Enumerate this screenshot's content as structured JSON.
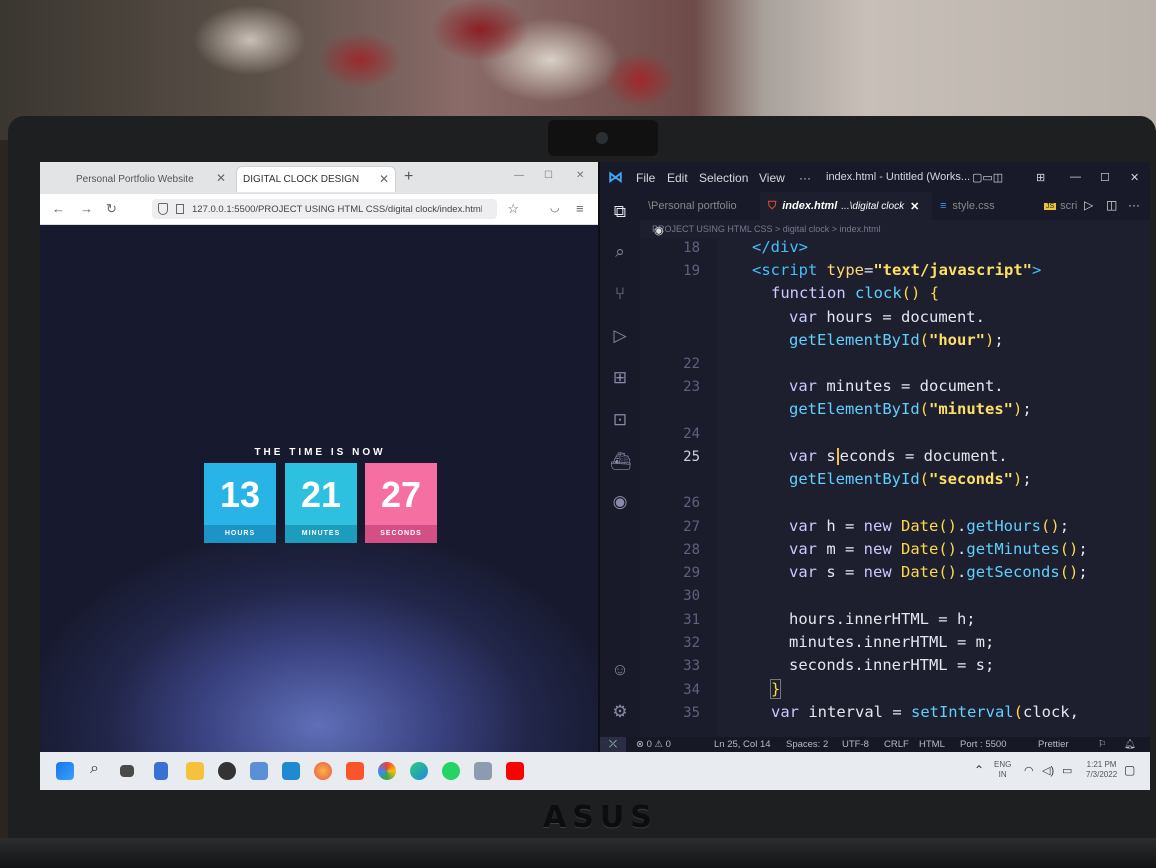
{
  "browser": {
    "tabs": [
      {
        "label": "Personal Portfolio Website"
      },
      {
        "label": "DIGITAL CLOCK DESIGN"
      }
    ],
    "new_tab": "+",
    "url": "127.0.0.1:5500/PROJECT USING HTML CSS/digital clock/index.html",
    "clock": {
      "heading": "THE TIME IS NOW",
      "hours": "13",
      "hours_label": "HOURS",
      "minutes": "21",
      "minutes_label": "MINUTES",
      "seconds": "27",
      "seconds_label": "SECONDS"
    }
  },
  "vscode": {
    "menu": [
      "File",
      "Edit",
      "Selection",
      "View",
      "···"
    ],
    "window_title": "index.html - Untitled (Works...",
    "tabs": [
      {
        "label": "\\Personal portfolio"
      },
      {
        "label": "index.html",
        "suffix": "...\\digital clock"
      },
      {
        "label": "style.css"
      },
      {
        "label": "scri"
      }
    ],
    "breadcrumb": "PROJECT USING HTML CSS > digital clock > index.html",
    "line_numbers": [
      "18",
      "19",
      "",
      "",
      "",
      "22",
      "23",
      "",
      "24",
      "25",
      "",
      "26",
      "27",
      "28",
      "29",
      "30",
      "31",
      "32",
      "33",
      "34",
      "35"
    ],
    "status": {
      "problems": "⊗ 0 ⚠ 0",
      "position": "Ln 25, Col 14",
      "spaces": "Spaces: 2",
      "encoding": "UTF-8",
      "eol": "CRLF",
      "language": "HTML",
      "port": "Port : 5500",
      "prettier": "Prettier"
    }
  },
  "taskbar": {
    "lang": "ENG",
    "region": "IN",
    "time": "1:21 PM",
    "date": "7/3/2022"
  },
  "brand": "ASUS"
}
